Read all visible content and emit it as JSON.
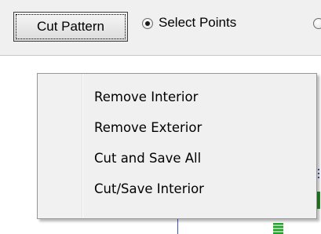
{
  "toolbar": {
    "cut_button_label": "Cut Pattern",
    "select_points": {
      "label": "Select Points",
      "checked": true
    }
  },
  "context_menu": {
    "items": [
      {
        "label": "Remove Interior"
      },
      {
        "label": "Remove Exterior"
      },
      {
        "label": "Cut and Save All"
      },
      {
        "label": "Cut/Save Interior"
      }
    ]
  },
  "colors": {
    "toolbar_bg": "#f0f0f0",
    "menu_bg": "#f0f0f0",
    "canvas_bg": "#ffffff",
    "plot_blue": "#3b57c7",
    "plot_green": "#22a22a"
  },
  "icons": {
    "radio_checked": "radio-checked-icon",
    "radio_unchecked": "radio-unchecked-icon"
  }
}
